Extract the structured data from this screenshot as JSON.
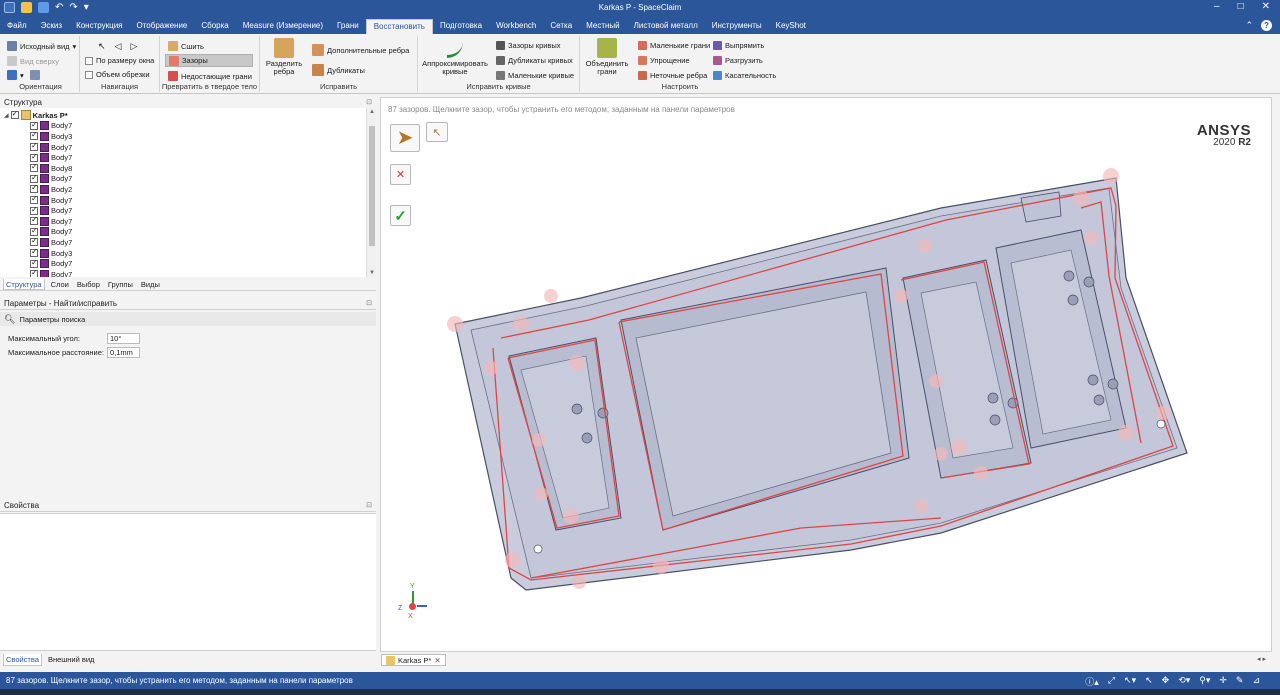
{
  "window": {
    "title": "Karkas P - SpaceClaim",
    "minimize": "–",
    "maximize": "□",
    "close": "✕"
  },
  "quick_access": {
    "undo": "↶",
    "redo": "↷",
    "more": "▾"
  },
  "tabs": [
    {
      "label": "Файл"
    },
    {
      "label": "Эскиз"
    },
    {
      "label": "Конструкция"
    },
    {
      "label": "Отображение"
    },
    {
      "label": "Сборка"
    },
    {
      "label": "Measure (Измерение)"
    },
    {
      "label": "Грани"
    },
    {
      "label": "Восстановить",
      "active": true
    },
    {
      "label": "Подготовка"
    },
    {
      "label": "Workbench"
    },
    {
      "label": "Сетка"
    },
    {
      "label": "Местный"
    },
    {
      "label": "Листовой металл"
    },
    {
      "label": "Инструменты"
    },
    {
      "label": "KeyShot"
    }
  ],
  "ribbon": {
    "orientation": {
      "label": "Ориентация",
      "home_view": "Исходный вид",
      "top_view": "Вид сверху"
    },
    "navigation": {
      "label": "Навигация",
      "fit_window": "По размеру окна",
      "clip_volume": "Объем обрезки"
    },
    "solidify": {
      "label": "Превратить в твердое тело",
      "stitch": "Сшить",
      "gaps": "Зазоры",
      "missing_faces": "Недостающие грани"
    },
    "fix": {
      "label": "Исправить",
      "split_edges": "Разделить ребра",
      "extra_edges": "Дополнительные ребра",
      "duplicates": "Дубликаты"
    },
    "fix_curves": {
      "label": "Исправить кривые",
      "fit_curves": "Аппроксимировать кривые",
      "curve_gaps": "Зазоры кривых",
      "duplicate_curves": "Дубликаты кривых",
      "small_curves": "Маленькие кривые"
    },
    "adjust": {
      "label": "Настроить",
      "merge_faces": "Объединить грани",
      "small_faces": "Маленькие грани",
      "simplify": "Упрощение",
      "inexact_edges": "Неточные ребра",
      "straighten": "Выпрямить",
      "relax": "Разгрузить",
      "tangency": "Касательность"
    }
  },
  "structure_panel": {
    "title": "Структура",
    "root": "Karkas P*",
    "bodies": [
      "Body7",
      "Body3",
      "Body7",
      "Body7",
      "Body8",
      "Body7",
      "Body2",
      "Body7",
      "Body7",
      "Body7",
      "Body7",
      "Body7",
      "Body3",
      "Body7",
      "Body7"
    ]
  },
  "panel_tabs": [
    {
      "label": "Структура",
      "active": true
    },
    {
      "label": "Слои"
    },
    {
      "label": "Выбор"
    },
    {
      "label": "Группы"
    },
    {
      "label": "Виды"
    }
  ],
  "options_panel": {
    "title": "Параметры - Найти/исправить",
    "search_params": "Параметры поиска",
    "max_angle_label": "Максимальный угол:",
    "max_angle_value": "10°",
    "max_distance_label": "Максимальное расстояние:",
    "max_distance_value": "0,1mm"
  },
  "properties_panel": {
    "title": "Свойства"
  },
  "bottom_tabs": [
    {
      "label": "Свойства",
      "active": true
    },
    {
      "label": "Внешний вид"
    }
  ],
  "viewport": {
    "hint": "87 зазоров. Щелкните зазор, чтобы устранить его методом, заданным на панели параметров",
    "brand": "ANSYS",
    "version_year": "2020",
    "version_release": "R2",
    "triad": {
      "x": "X",
      "y": "Y",
      "z": "Z"
    },
    "colors": {
      "gap_outline": "#e04545",
      "part_fill": "#c9ccdc",
      "part_edge": "#4a4f66",
      "marker": "#f3b9b9"
    }
  },
  "doc_tab": {
    "label": "Karkas P*",
    "close": "✕"
  },
  "status": {
    "message": "87 зазоров. Щелкните зазор, чтобы устранить его методом, заданным на панели параметров"
  }
}
